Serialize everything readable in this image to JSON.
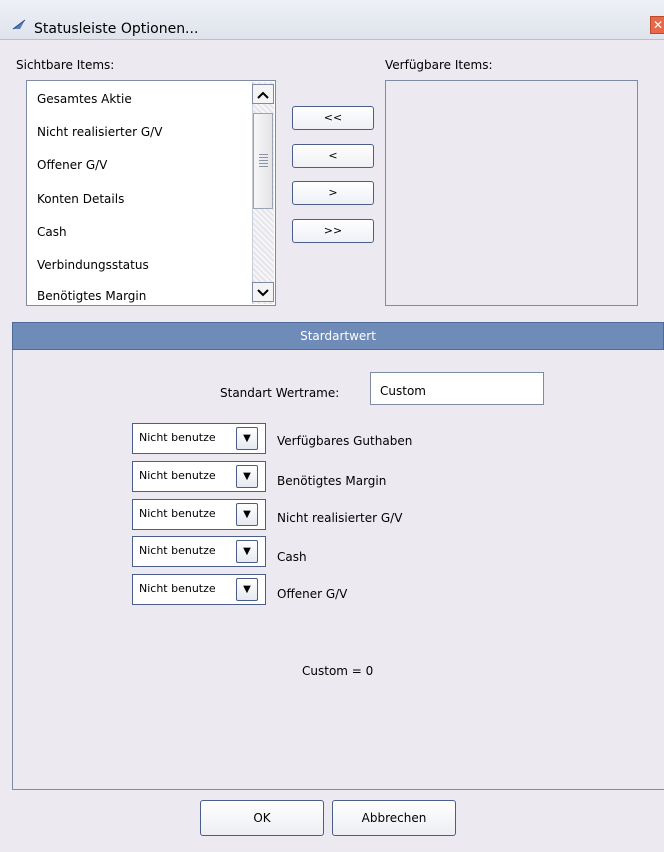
{
  "window": {
    "title": "Statusleiste Optionen...",
    "close_symbol": "✕",
    "app_icon": "app-logo-icon"
  },
  "visible_items": {
    "label": "Sichtbare Items:",
    "items": [
      "Gesamtes Aktie",
      "Nicht realisierter G/V",
      "Offener G/V",
      "Konten Details",
      "Cash",
      "Verbindungsstatus",
      "Benötigtes Margin"
    ]
  },
  "available_items": {
    "label": "Verfügbare Items:",
    "items": []
  },
  "move_buttons": {
    "all_left": "<<",
    "left": "<",
    "right": ">",
    "all_right": ">>"
  },
  "defaults": {
    "header": "Stardartwert",
    "name_label": "Standart Wertrame:",
    "name_value": "Custom",
    "rows": [
      {
        "select": "Nicht benutze",
        "label": "Verfügbares Guthaben"
      },
      {
        "select": "Nicht benutze",
        "label": "Benötigtes Margin"
      },
      {
        "select": "Nicht benutze",
        "label": "Nicht realisierter G/V"
      },
      {
        "select": "Nicht benutze",
        "label": "Cash"
      },
      {
        "select": "Nicht benutze",
        "label": "Offener G/V"
      }
    ],
    "formula": "Custom = 0"
  },
  "buttons": {
    "ok": "OK",
    "cancel": "Abbrechen"
  },
  "colors": {
    "section_header": "#6f8cb8",
    "close_button": "#e8684a"
  }
}
